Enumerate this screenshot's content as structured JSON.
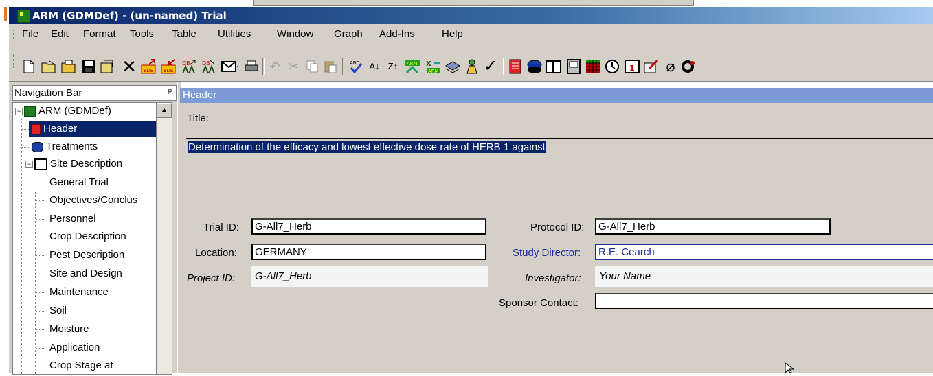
{
  "window": {
    "title": "ARM (GDMDef) - (un-named) Trial"
  },
  "menu": [
    "File",
    "Edit",
    "Format",
    "Tools",
    "Table",
    "Utilities",
    "Window",
    "Graph",
    "Add-Ins",
    "Help"
  ],
  "toolbar_icons": [
    "new-icon",
    "open-icon",
    "open-folder-icon",
    "save-icon",
    "save-as-icon",
    "close-icon",
    "export-edit-icon",
    "import-edit-icon",
    "db-link-icon",
    "db-export-icon",
    "email-icon",
    "print-icon",
    "undo-icon",
    "cut-icon",
    "copy-icon",
    "paste-icon",
    "spellcheck-icon",
    "sort-asc-icon",
    "sort-desc-icon",
    "arm-report-icon",
    "arm-excel-icon",
    "arm-stack-icon",
    "person-icon",
    "checkmark-icon",
    "header-icon",
    "treatments-icon",
    "book-icon",
    "panel-icon",
    "grid-icon",
    "clock-icon",
    "calendar-icon",
    "edit-tool-icon",
    "paperclip-icon",
    "settings-icon"
  ],
  "nav": {
    "title": "Navigation Bar",
    "pin": "ᵖ",
    "root": "ARM (GDMDef)",
    "items": {
      "header": "Header",
      "treatments": "Treatments",
      "site_description": "Site Description",
      "general_trial": "General Trial",
      "objectives": "Objectives/Conclus",
      "personnel": "Personnel",
      "crop_description": "Crop Description",
      "pest_description": "Pest Description",
      "site_design": "Site and Design",
      "maintenance": "Maintenance",
      "soil": "Soil",
      "moisture": "Moisture",
      "application": "Application",
      "crop_stage": "Crop Stage at"
    }
  },
  "header_panel": {
    "title": "Header",
    "title_label": "Title:",
    "title_value": "Determination of the efficacy and lowest effective dose rate of HERB 1 against",
    "trial_id_label": "Trial ID:",
    "trial_id": "G-All7_Herb",
    "location_label": "Location:",
    "location": "GERMANY",
    "project_id_label": "Project ID:",
    "project_id": "G-All7_Herb",
    "protocol_id_label": "Protocol ID:",
    "protocol_id": "G-All7_Herb",
    "study_director_label": "Study Director:",
    "study_director": "R.E. Cearch",
    "investigator_label": "Investigator:",
    "investigator": "Your Name",
    "sponsor_contact_label": "Sponsor Contact:",
    "sponsor_contact": ""
  }
}
